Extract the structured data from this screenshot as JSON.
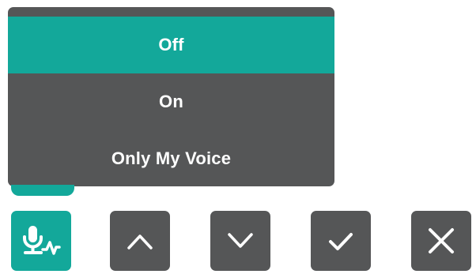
{
  "menu": {
    "items": [
      {
        "label": "Off",
        "selected": true
      },
      {
        "label": "On",
        "selected": false
      },
      {
        "label": "Only My Voice",
        "selected": false
      }
    ]
  },
  "toolbar": {
    "buttons": [
      {
        "name": "voice-isolation-button",
        "icon": "microphone-waveform-icon"
      },
      {
        "name": "up-button",
        "icon": "chevron-up-icon"
      },
      {
        "name": "down-button",
        "icon": "chevron-down-icon"
      },
      {
        "name": "confirm-button",
        "icon": "checkmark-icon"
      },
      {
        "name": "close-button",
        "icon": "close-icon"
      }
    ]
  },
  "colors": {
    "accent": "#13a89a",
    "panel": "#555657",
    "text": "#ffffff"
  }
}
